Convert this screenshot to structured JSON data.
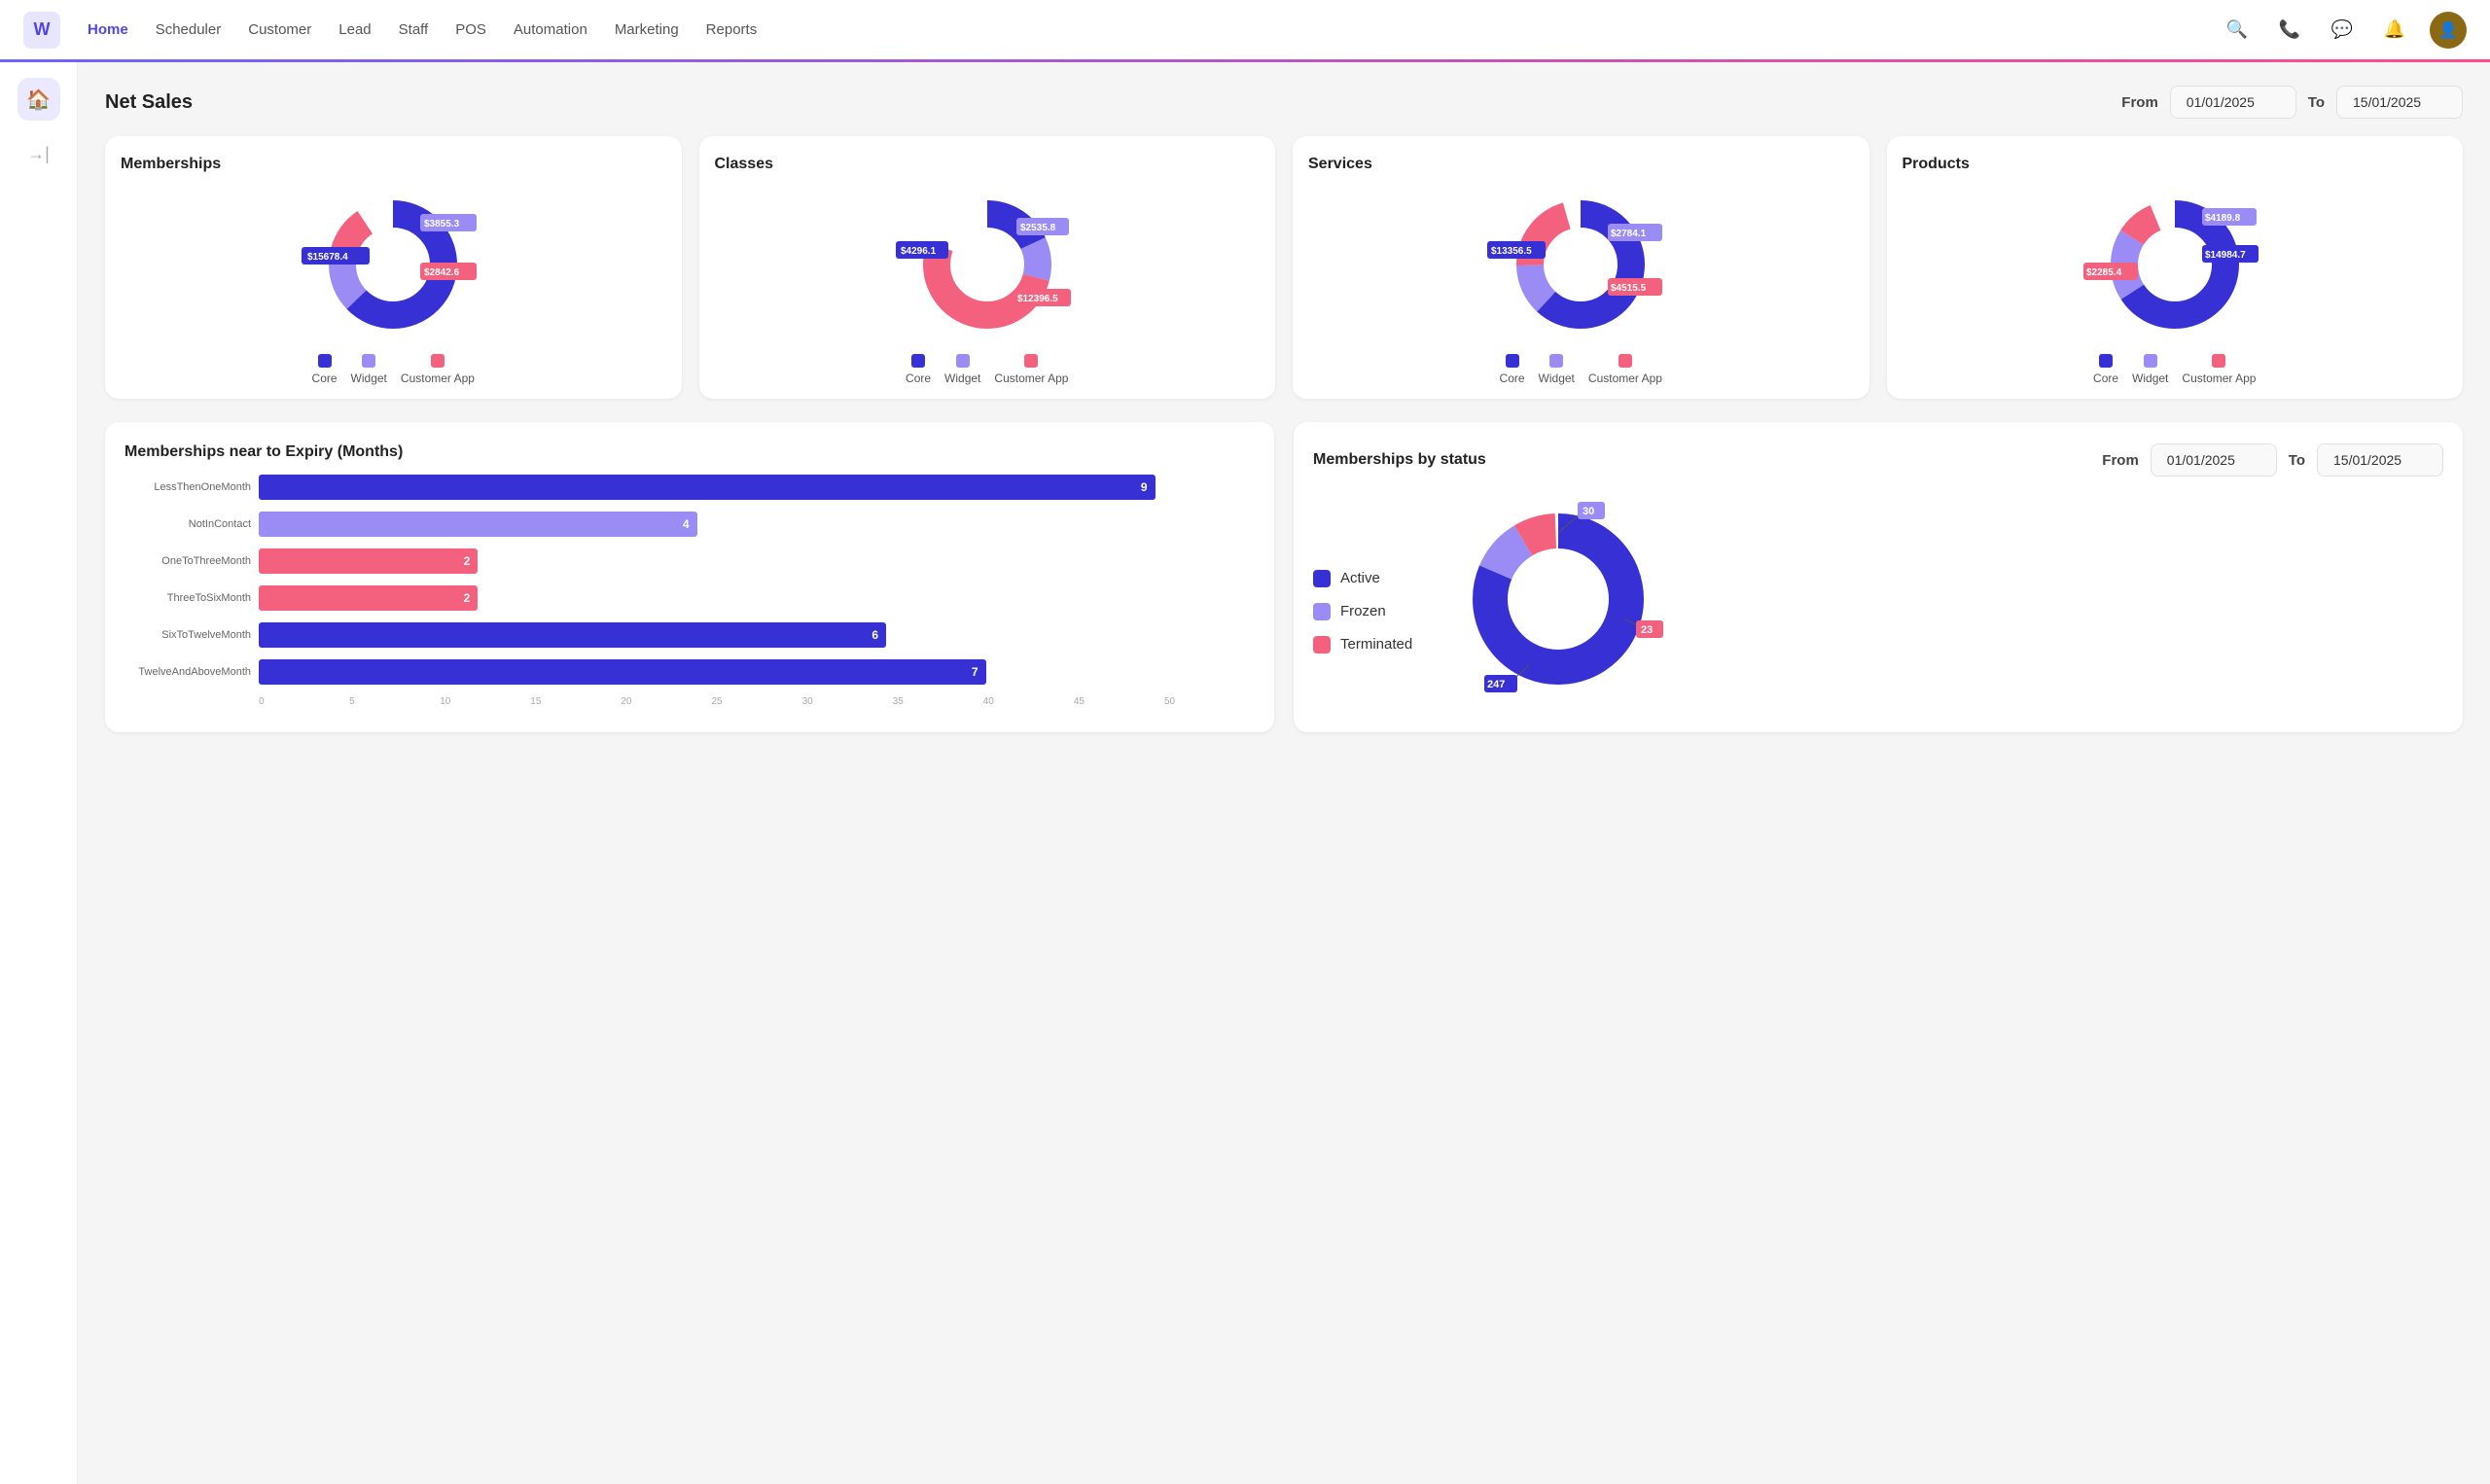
{
  "nav": {
    "logo": "W",
    "links": [
      {
        "label": "Home",
        "active": true
      },
      {
        "label": "Scheduler",
        "active": false
      },
      {
        "label": "Customer",
        "active": false
      },
      {
        "label": "Lead",
        "active": false
      },
      {
        "label": "Staff",
        "active": false
      },
      {
        "label": "POS",
        "active": false
      },
      {
        "label": "Automation",
        "active": false
      },
      {
        "label": "Marketing",
        "active": false
      },
      {
        "label": "Reports",
        "active": false
      }
    ]
  },
  "header": {
    "title": "Net Sales",
    "from_label": "From",
    "to_label": "To",
    "from_date": "01/01/2025",
    "to_date": "15/01/2025"
  },
  "charts": {
    "memberships": {
      "title": "Memberships",
      "segments": [
        {
          "label": "Core",
          "value": 15678.4,
          "display": "$15678.4",
          "color": "#3730d4",
          "pct": 63
        },
        {
          "label": "Widget",
          "value": 3855.3,
          "display": "$3855.3",
          "color": "#9b8cf5",
          "pct": 16
        },
        {
          "label": "Customer App",
          "value": 2842.6,
          "display": "$2842.6",
          "color": "#f4617f",
          "pct": 12
        }
      ]
    },
    "classes": {
      "title": "Classes",
      "segments": [
        {
          "label": "Core",
          "value": 4296.1,
          "display": "$4296.1",
          "color": "#3730d4",
          "pct": 18
        },
        {
          "label": "Widget",
          "value": 2535.8,
          "display": "$2535.8",
          "color": "#9b8cf5",
          "pct": 11
        },
        {
          "label": "Customer App",
          "value": 12396.5,
          "display": "$12396.5",
          "color": "#f4617f",
          "pct": 52
        }
      ]
    },
    "services": {
      "title": "Services",
      "segments": [
        {
          "label": "Core",
          "value": 13356.5,
          "display": "$13356.5",
          "color": "#3730d4",
          "pct": 62
        },
        {
          "label": "Widget",
          "value": 2784.1,
          "display": "$2784.1",
          "color": "#9b8cf5",
          "pct": 13
        },
        {
          "label": "Customer App",
          "value": 4515.5,
          "display": "$4515.5",
          "color": "#f4617f",
          "pct": 21
        }
      ]
    },
    "products": {
      "title": "Products",
      "segments": [
        {
          "label": "Core",
          "value": 14984.7,
          "display": "$14984.7",
          "color": "#3730d4",
          "pct": 66
        },
        {
          "label": "Widget",
          "value": 4189.8,
          "display": "$4189.8",
          "color": "#9b8cf5",
          "pct": 18
        },
        {
          "label": "Customer App",
          "value": 2285.4,
          "display": "$2285.4",
          "color": "#f4617f",
          "pct": 10
        }
      ]
    }
  },
  "expiry": {
    "title": "Memberships near to Expiry (Months)",
    "bars": [
      {
        "label": "LessThenOneMonth",
        "value": 9,
        "color": "#3730d4",
        "pct": 90
      },
      {
        "label": "NotInContact",
        "value": 4,
        "color": "#9b8cf5",
        "pct": 44
      },
      {
        "label": "OneToThreeMonth",
        "value": 2,
        "color": "#f4617f",
        "pct": 22
      },
      {
        "label": "ThreeToSixMonth",
        "value": 2,
        "color": "#f4617f",
        "pct": 22
      },
      {
        "label": "SixToTwelveMonth",
        "value": 6,
        "color": "#3730d4",
        "pct": 63
      },
      {
        "label": "TwelveAndAboveMonth",
        "value": 7,
        "color": "#3730d4",
        "pct": 73
      }
    ],
    "axis": [
      "0",
      "5",
      "10",
      "15",
      "20",
      "25",
      "30",
      "35",
      "40",
      "45",
      "50"
    ]
  },
  "byStatus": {
    "title": "Memberships by status",
    "from_label": "From",
    "to_label": "To",
    "from_date": "01/01/2025",
    "to_date": "15/01/2025",
    "legend": [
      {
        "label": "Active",
        "color": "#3730d4"
      },
      {
        "label": "Frozen",
        "color": "#9b8cf5"
      },
      {
        "label": "Terminated",
        "color": "#f4617f"
      }
    ],
    "segments": [
      {
        "label": "Active",
        "value": 247,
        "color": "#3730d4",
        "pct": 81
      },
      {
        "label": "Frozen",
        "value": 30,
        "color": "#9b8cf5",
        "pct": 10
      },
      {
        "label": "Terminated",
        "value": 23,
        "color": "#f4617f",
        "pct": 8
      }
    ]
  }
}
